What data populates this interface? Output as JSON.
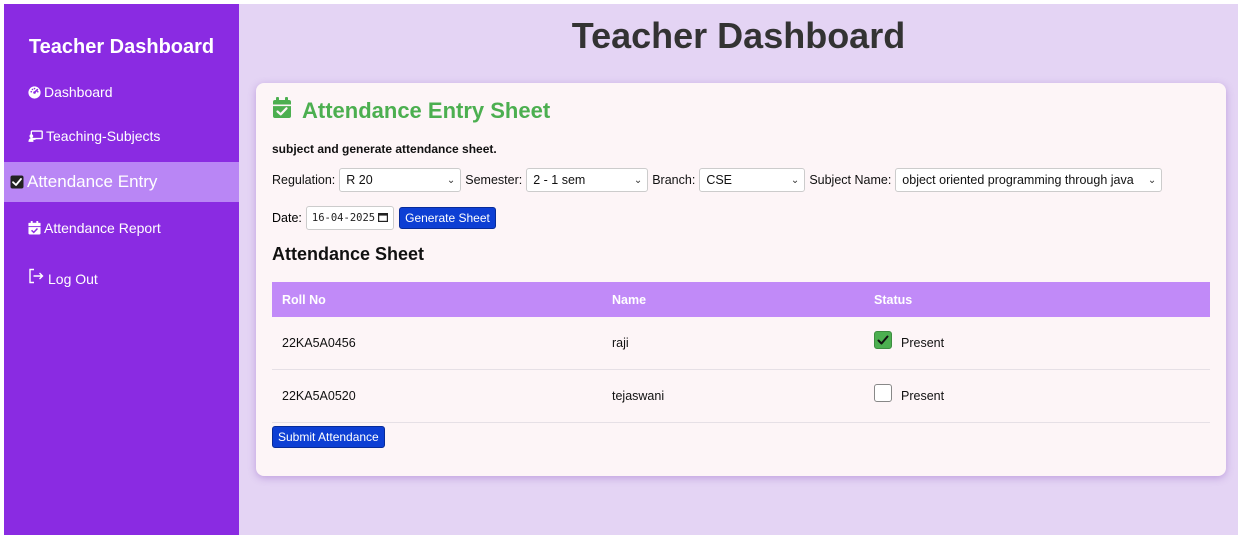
{
  "sidebar": {
    "title": "Teacher Dashboard",
    "items": [
      {
        "label": "Dashboard",
        "icon": "dashboard-gauge-icon"
      },
      {
        "label": "Teaching-Subjects",
        "icon": "chalkboard-teacher-icon"
      },
      {
        "label": "Attendance Entry",
        "icon": "checkbox-checked-icon",
        "active": true
      },
      {
        "label": "Attendance Report",
        "icon": "calendar-check-icon"
      },
      {
        "label": "Log Out",
        "icon": "logout-arrow-icon"
      }
    ]
  },
  "header": {
    "title": "Teacher Dashboard"
  },
  "card": {
    "title": "Attendance Entry Sheet",
    "icon": "calendar-check-icon",
    "instructions": "subject and generate attendance sheet.",
    "filters": {
      "regulation_label": "Regulation:",
      "regulation_value": "R 20",
      "semester_label": "Semester:",
      "semester_value": "2 - 1 sem",
      "branch_label": "Branch:",
      "branch_value": "CSE",
      "subject_label": "Subject Name:",
      "subject_value": "object oriented programming through java"
    },
    "date_label": "Date:",
    "date_value": "16-04-2025",
    "generate_label": "Generate Sheet",
    "sheet_title": "Attendance Sheet",
    "columns": [
      "Roll No",
      "Name",
      "Status"
    ],
    "rows": [
      {
        "roll": "22KA5A0456",
        "name": "raji",
        "status": "Present",
        "checked": true
      },
      {
        "roll": "22KA5A0520",
        "name": "tejaswani",
        "status": "Present",
        "checked": false
      }
    ],
    "submit_label": "Submit Attendance"
  },
  "colors": {
    "sidebar_bg": "#8a2be2",
    "sidebar_active": "#b986f5",
    "page_bg": "#e4d4f4",
    "accent_green": "#4caf50",
    "table_header": "#c18af8",
    "button_blue": "#0d3fd4"
  }
}
